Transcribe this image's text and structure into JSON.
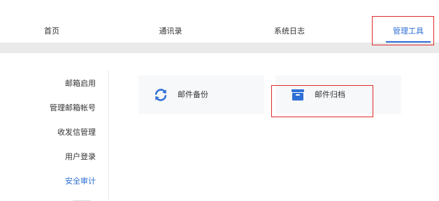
{
  "topnav": {
    "items": [
      "首页",
      "通讯录",
      "系统日志",
      "管理工具"
    ],
    "active_index": 3
  },
  "sidebar": {
    "items": [
      "邮箱启用",
      "管理邮箱帐号",
      "收发信管理",
      "用户登录",
      "安全审计"
    ],
    "active_index": 4
  },
  "tools": [
    {
      "label": "邮件备份",
      "icon": "refresh-icon"
    },
    {
      "label": "邮件归档",
      "icon": "archive-box-icon"
    }
  ],
  "colors": {
    "accent": "#2f6fd6",
    "highlight_box": "#e02b2b",
    "band": "#eaeaea",
    "card_bg": "#f7f8f9"
  }
}
